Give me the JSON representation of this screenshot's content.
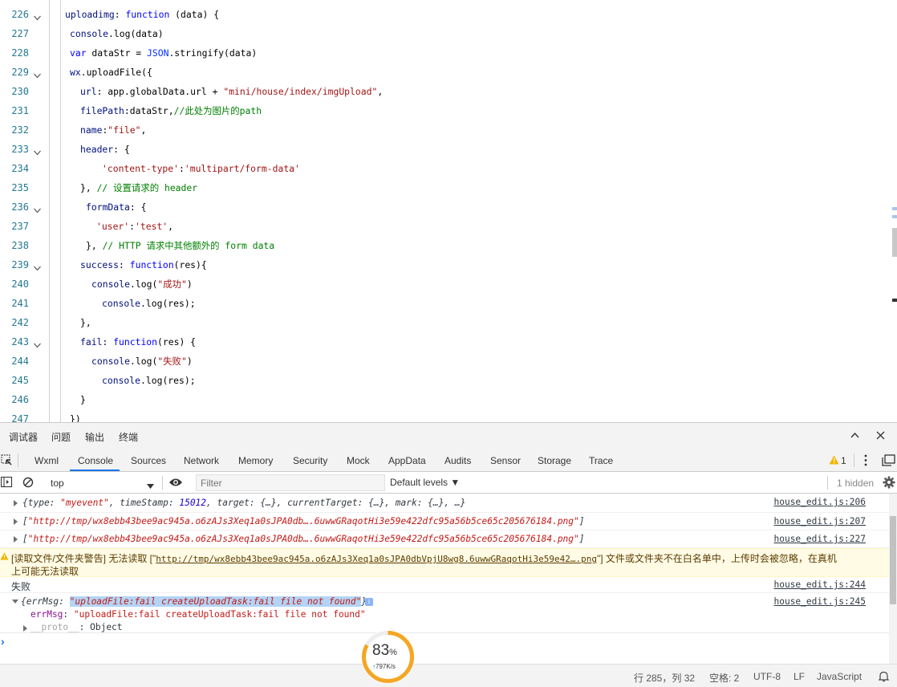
{
  "editor": {
    "lines": [
      {
        "n": "226",
        "fold": true
      },
      {
        "n": "227",
        "fold": false
      },
      {
        "n": "228",
        "fold": false
      },
      {
        "n": "229",
        "fold": true
      },
      {
        "n": "230",
        "fold": false
      },
      {
        "n": "231",
        "fold": false
      },
      {
        "n": "232",
        "fold": false
      },
      {
        "n": "233",
        "fold": true
      },
      {
        "n": "234",
        "fold": false
      },
      {
        "n": "235",
        "fold": false
      },
      {
        "n": "236",
        "fold": true
      },
      {
        "n": "237",
        "fold": false
      },
      {
        "n": "238",
        "fold": false
      },
      {
        "n": "239",
        "fold": true
      },
      {
        "n": "240",
        "fold": false
      },
      {
        "n": "241",
        "fold": false
      },
      {
        "n": "242",
        "fold": false
      },
      {
        "n": "243",
        "fold": true
      },
      {
        "n": "244",
        "fold": false
      },
      {
        "n": "245",
        "fold": false
      },
      {
        "n": "246",
        "fold": false
      },
      {
        "n": "247",
        "fold": false
      }
    ],
    "code": {
      "l226": [
        "uploadimg",
        ": ",
        "function",
        " (data) {"
      ],
      "l227": [
        "console",
        ".log(data)"
      ],
      "l228": [
        "var",
        " dataStr = ",
        "JSON",
        ".stringify(data)"
      ],
      "l229": [
        "wx",
        ".uploadFile({"
      ],
      "l230": [
        "url",
        ": app.globalData.url + ",
        "\"mini/house/index/imgUpload\"",
        ","
      ],
      "l231": [
        "filePath",
        ":dataStr,",
        "//此处为图片的path"
      ],
      "l232": [
        "name",
        ":",
        "\"file\"",
        ","
      ],
      "l233": [
        "header",
        ": {"
      ],
      "l234": [
        "'content-type'",
        ":",
        "'multipart/form-data'"
      ],
      "l235": [
        "}, ",
        "// 设置请求的 header"
      ],
      "l236": [
        "formData",
        ": {"
      ],
      "l237": [
        "'user'",
        ":",
        "'test'",
        ","
      ],
      "l238": [
        "}, ",
        "// HTTP 请求中其他额外的 form data"
      ],
      "l239": [
        "success",
        ": ",
        "function",
        "(res){"
      ],
      "l240": [
        "console",
        ".log(",
        "\"成功\"",
        ")"
      ],
      "l241": [
        "console",
        ".log(res);"
      ],
      "l242": [
        "},"
      ],
      "l243": [
        "fail",
        ": ",
        "function",
        "(res) {"
      ],
      "l244": [
        "console",
        ".log(",
        "\"失败\"",
        ")"
      ],
      "l245": [
        "console",
        ".log(res);"
      ],
      "l246": [
        "}"
      ],
      "l247": [
        "})"
      ]
    }
  },
  "devtools": {
    "panel_tabs": [
      "调试器",
      "问题",
      "输出",
      "终端"
    ],
    "tool_tabs": [
      "Wxml",
      "Console",
      "Sources",
      "Network",
      "Memory",
      "Security",
      "Mock",
      "AppData",
      "Audits",
      "Sensor",
      "Storage",
      "Trace"
    ],
    "active_tool_tab": "Console",
    "warning_count": "1",
    "context_select": "top",
    "filter_placeholder": "Filter",
    "levels_label": "Default levels ▼",
    "hidden_label": "1 hidden",
    "colors": {
      "accent": "#1a73e8",
      "warn_bg": "#fffbe5",
      "string": "#c41a16",
      "key": "#881391"
    }
  },
  "console": {
    "row1": {
      "text_pre": "{type: ",
      "type_val": "\"myevent\"",
      "text_mid": ", timeStamp: ",
      "ts": "15012",
      "text_post": ", target: {…}, currentTarget: {…}, mark: {…}, …}",
      "source": "house_edit.js:206"
    },
    "row2": {
      "pre": "[",
      "val": "\"http://tmp/wx8ebb43bee9ac945a.o6zAJs3Xeq1a0sJPA0db….6uwwGRaqotHi3e59e422dfc95a56b5ce65c205676184.png\"",
      "post": "]",
      "source": "house_edit.js:207"
    },
    "row3": {
      "pre": "[",
      "val": "\"http://tmp/wx8ebb43bee9ac945a.o6zAJs3Xeq1a0sJPA0db….6uwwGRaqotHi3e59e422dfc95a56b5ce65c205676184.png\"",
      "post": "]",
      "source": "house_edit.js:227"
    },
    "warning": {
      "pre": "[读取文件/文件夹警告] 无法读取 [\"",
      "link": "http://tmp/wx8ebb43bee9ac945a.o6zAJs3Xeq1a0sJPA0dbVpjU8wg8.6uwwGRaqotHi3e59e42….png",
      "post": "\"] 文件或文件夹不在白名单中，上传时会被忽略，在真机",
      "line2": "上可能无法读取"
    },
    "row_fail": {
      "text": "失败",
      "source": "house_edit.js:244"
    },
    "row_err": {
      "pre": "{errMsg: ",
      "val": "\"uploadFile:fail createUploadTask:fail file not found\"",
      "post": "}",
      "source": "house_edit.js:245"
    },
    "err_prop": {
      "key": "errMsg",
      "sep": ": ",
      "val": "\"uploadFile:fail createUploadTask:fail file not found\""
    },
    "proto": {
      "key": "__proto__",
      "sep": ": ",
      "val": "Object"
    },
    "prompt": "›"
  },
  "perf_widget": {
    "percent": "83",
    "unit": "%",
    "speed": "797K/s",
    "fill": 0.83,
    "color": "#f5a623"
  },
  "status_bar": {
    "position": "行 285，列 32",
    "indent": "空格: 2",
    "encoding": "UTF-8",
    "eol": "LF",
    "language": "JavaScript"
  }
}
